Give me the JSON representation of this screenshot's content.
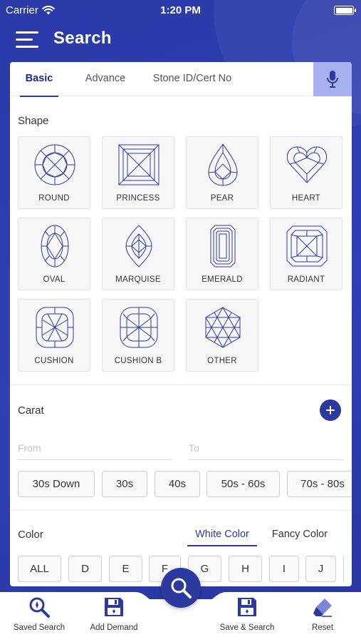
{
  "status_bar": {
    "carrier": "Carrier",
    "time": "1:20 PM"
  },
  "header": {
    "title": "Search",
    "menu_icon": "hamburger-menu-icon"
  },
  "tabs": [
    {
      "label": "Basic",
      "active": true
    },
    {
      "label": "Advance",
      "active": false
    },
    {
      "label": "Stone ID/Cert No",
      "active": false
    }
  ],
  "mic_icon": "microphone-icon",
  "shape": {
    "label": "Shape",
    "items": [
      {
        "label": "ROUND",
        "icon": "round-diamond-icon"
      },
      {
        "label": "PRINCESS",
        "icon": "princess-diamond-icon"
      },
      {
        "label": "PEAR",
        "icon": "pear-diamond-icon"
      },
      {
        "label": "HEART",
        "icon": "heart-diamond-icon"
      },
      {
        "label": "OVAL",
        "icon": "oval-diamond-icon"
      },
      {
        "label": "MARQUISE",
        "icon": "marquise-diamond-icon"
      },
      {
        "label": "EMERALD",
        "icon": "emerald-diamond-icon"
      },
      {
        "label": "RADIANT",
        "icon": "radiant-diamond-icon"
      },
      {
        "label": "CUSHION",
        "icon": "cushion-diamond-icon"
      },
      {
        "label": "CUSHION B",
        "icon": "cushion-b-diamond-icon"
      },
      {
        "label": "OTHER",
        "icon": "other-diamond-icon"
      }
    ]
  },
  "carat": {
    "label": "Carat",
    "from_placeholder": "From",
    "to_placeholder": "To",
    "chips": [
      "30s Down",
      "30s",
      "40s",
      "50s - 60s",
      "70s - 80s"
    ]
  },
  "color": {
    "label": "Color",
    "tabs": [
      {
        "label": "White Color",
        "active": true
      },
      {
        "label": "Fancy Color",
        "active": false
      }
    ],
    "chips": [
      "ALL",
      "D",
      "E",
      "F",
      "G",
      "H",
      "I",
      "J"
    ]
  },
  "bottom_nav": [
    {
      "label": "Saved Search",
      "icon": "saved-search-icon"
    },
    {
      "label": "Add Demand",
      "icon": "floppy-disk-icon"
    },
    {
      "label": "Save & Search",
      "icon": "floppy-disk-icon"
    },
    {
      "label": "Reset",
      "icon": "eraser-icon"
    }
  ],
  "fab_icon": "search-icon",
  "colors": {
    "primary": "#2c3a9f",
    "header_bg": "#2f3fb4",
    "mic_bg": "#a9b0f0"
  }
}
